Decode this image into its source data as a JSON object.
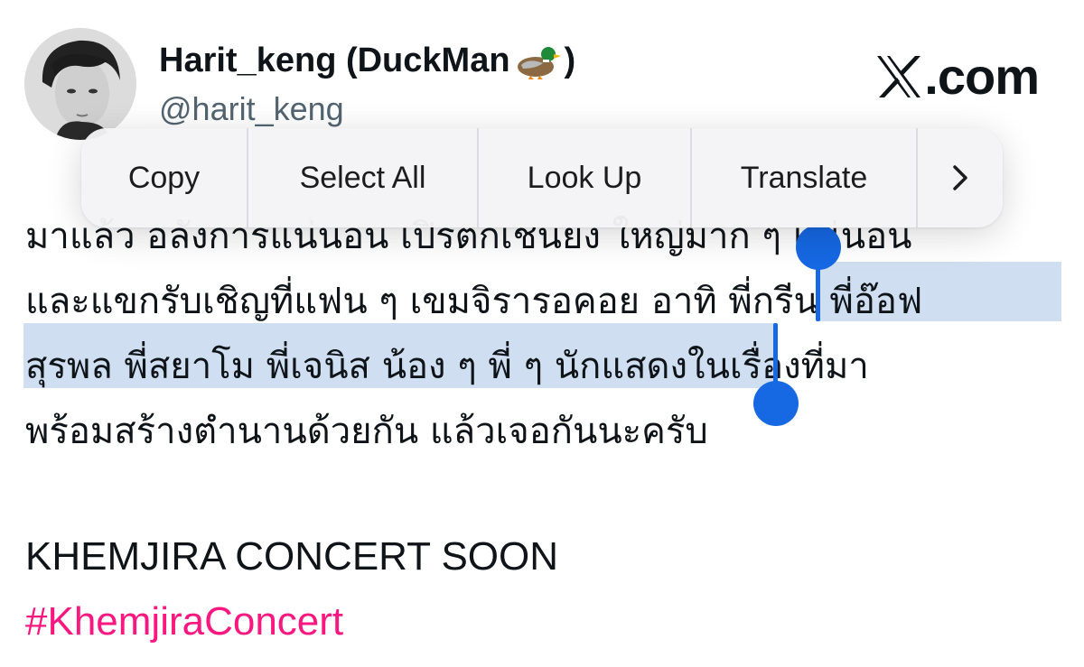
{
  "user": {
    "display_name": "Harit_keng (DuckMan",
    "display_name_close": ")",
    "handle": "@harit_keng",
    "avatar_icon": "profile-photo"
  },
  "brand": {
    "logo_icon": "x-logo-icon",
    "suffix": ".com"
  },
  "context_menu": {
    "copy": "Copy",
    "select_all": "Select All",
    "look_up": "Look Up",
    "translate": "Translate",
    "more_icon": "chevron-right-icon"
  },
  "tweet": {
    "line1": "มาแล้ว อลังการแน่นอน เปิรตกเชนยง ใหญ่มาก ๆ แน่นอน",
    "line2_before": "และแขกรับเชิญที่แฟน ๆ เขมจิรารอคอย  อาทิ ",
    "line2_selected": "พี่กรีน พี่อ๊อฟ",
    "line3_selected": "สุรพล พี่สยาโม พี่เจนิส น้อง ๆ พี่ ๆ นักแสดง",
    "line3_after": "ในเรื่องที่มา",
    "line4": "พร้อมสร้างตำนานด้วยกัน แล้วเจอกันนะครับ",
    "concert": "KHEMJIRA CONCERT SOON",
    "hashtag": "#KhemjiraConcert"
  },
  "colors": {
    "selection": "#5f91cd",
    "handle": "#1668e3",
    "hashtag": "#f91880"
  }
}
